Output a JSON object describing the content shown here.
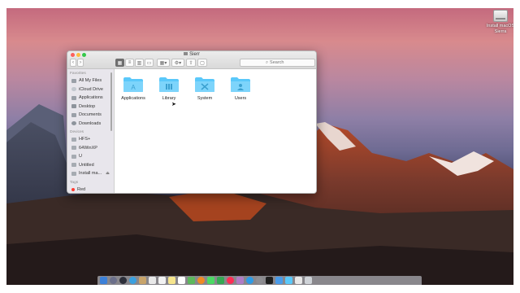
{
  "desktop": {
    "drive_label": "Install macOS Sierra"
  },
  "finder": {
    "window_title": "Sierr",
    "search_placeholder": "Search",
    "sidebar": {
      "favorites_header": "Favorites",
      "favorites": [
        {
          "label": "All My Files",
          "icon": "all-files-icon"
        },
        {
          "label": "iCloud Drive",
          "icon": "cloud-icon"
        },
        {
          "label": "Applications",
          "icon": "applications-icon"
        },
        {
          "label": "Desktop",
          "icon": "desktop-icon"
        },
        {
          "label": "Documents",
          "icon": "documents-icon"
        },
        {
          "label": "Downloads",
          "icon": "downloads-icon"
        }
      ],
      "devices_header": "Devices",
      "devices": [
        {
          "label": "HFS+",
          "icon": "disk-icon"
        },
        {
          "label": "64WinXP",
          "icon": "disk-icon"
        },
        {
          "label": "U",
          "icon": "disk-icon"
        },
        {
          "label": "Untitled",
          "icon": "disk-icon"
        },
        {
          "label": "Install ma...",
          "icon": "disk-icon"
        }
      ],
      "tags_header": "Tags",
      "tags": [
        {
          "label": "Red",
          "color": "#ff3b30"
        }
      ]
    },
    "folders": [
      {
        "label": "Applications",
        "glyph": "A"
      },
      {
        "label": "Library",
        "glyph": "L"
      },
      {
        "label": "System",
        "glyph": "X"
      },
      {
        "label": "Users",
        "glyph": "U"
      }
    ]
  },
  "colors": {
    "folder_blue": "#5ac8fa",
    "close": "#fc605c",
    "minimize": "#fdbc40",
    "zoom": "#34c84a"
  }
}
